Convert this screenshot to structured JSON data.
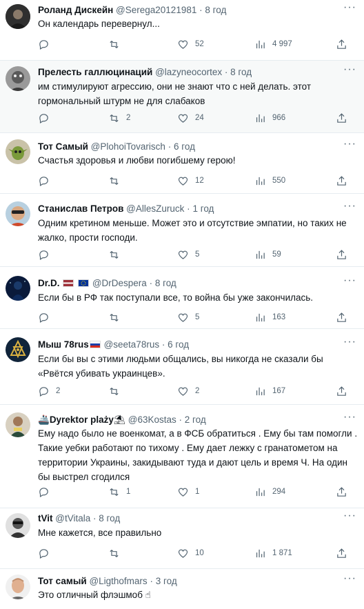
{
  "tweets": [
    {
      "name": "Роланд Дискейн",
      "handle": "@Serega20121981",
      "dot": "·",
      "time": "8 год",
      "text": "Он календарь перевернул...",
      "replies": "",
      "retweets": "",
      "likes": "52",
      "views": "4 997"
    },
    {
      "name": "Прелесть галлюцинаций",
      "handle": "@lazyneocortex",
      "dot": "·",
      "time": "8 год",
      "text": "им стимулируют агрессию, они не знают что с ней делать. этот гормональный штурм не для слабаков",
      "replies": "",
      "retweets": "2",
      "likes": "24",
      "views": "966"
    },
    {
      "name": "Тот Самый",
      "handle": "@PlohoiTovarisch",
      "dot": "·",
      "time": "6 год",
      "text": "Счастья здоровья и любви погибшему герою!",
      "replies": "",
      "retweets": "",
      "likes": "12",
      "views": "550"
    },
    {
      "name": "Станислав Петров",
      "handle": "@AllesZuruck",
      "dot": "·",
      "time": "1 год",
      "text": "Одним кретином меньше. Может это и отсутствие эмпатии, но таких не жалко, прости господи.",
      "replies": "",
      "retweets": "",
      "likes": "5",
      "views": "59"
    },
    {
      "name": "Dr.D.",
      "handle": "@DrDespera",
      "dot": "·",
      "time": "8 год",
      "text": "Если бы в РФ так поступали все, то война бы уже закончилась.",
      "replies": "",
      "retweets": "",
      "likes": "5",
      "views": "163"
    },
    {
      "name": "Мыш 78rus",
      "handle": "@seeta78rus",
      "dot": "·",
      "time": "6 год",
      "text": "Если бы вы с этими людьми общались, вы никогда не сказали бы «Рвётся убивать украинцев».",
      "replies": "2",
      "retweets": "",
      "likes": "2",
      "views": "167"
    },
    {
      "name": "Dyrektor plaży",
      "handle": "@63Kostas",
      "dot": "·",
      "time": "2 год",
      "text": "Ему надо было не военкомат,  а в ФСБ обратиться . Ему бы там помогли . Такие уебки работают по тихому . Ему дает лежку с гранатометом на территории Украины,  закидывают туда и дают цель и время Ч. На один бы выстрел сгодился",
      "replies": "",
      "retweets": "1",
      "likes": "1",
      "views": "294"
    },
    {
      "name": "tVit",
      "handle": "@tVitala",
      "dot": "·",
      "time": "8 год",
      "text": "Мне кажется, все правильно",
      "replies": "",
      "retweets": "",
      "likes": "10",
      "views": "1 871"
    },
    {
      "name": "Тот самый",
      "handle": "@Ligthofmars",
      "dot": "·",
      "time": "3 год",
      "text": "Это отличный флэшмоб ☝",
      "replies": "",
      "retweets": "",
      "likes": "",
      "views": ""
    }
  ],
  "icons": [
    "reply-icon",
    "retweet-icon",
    "like-icon",
    "views-icon",
    "share-icon",
    "more-icon"
  ],
  "colors": {
    "text": "#0f1419",
    "secondary": "#536471",
    "divider": "#e6ecf0",
    "highlight": "#f7f9f9"
  }
}
